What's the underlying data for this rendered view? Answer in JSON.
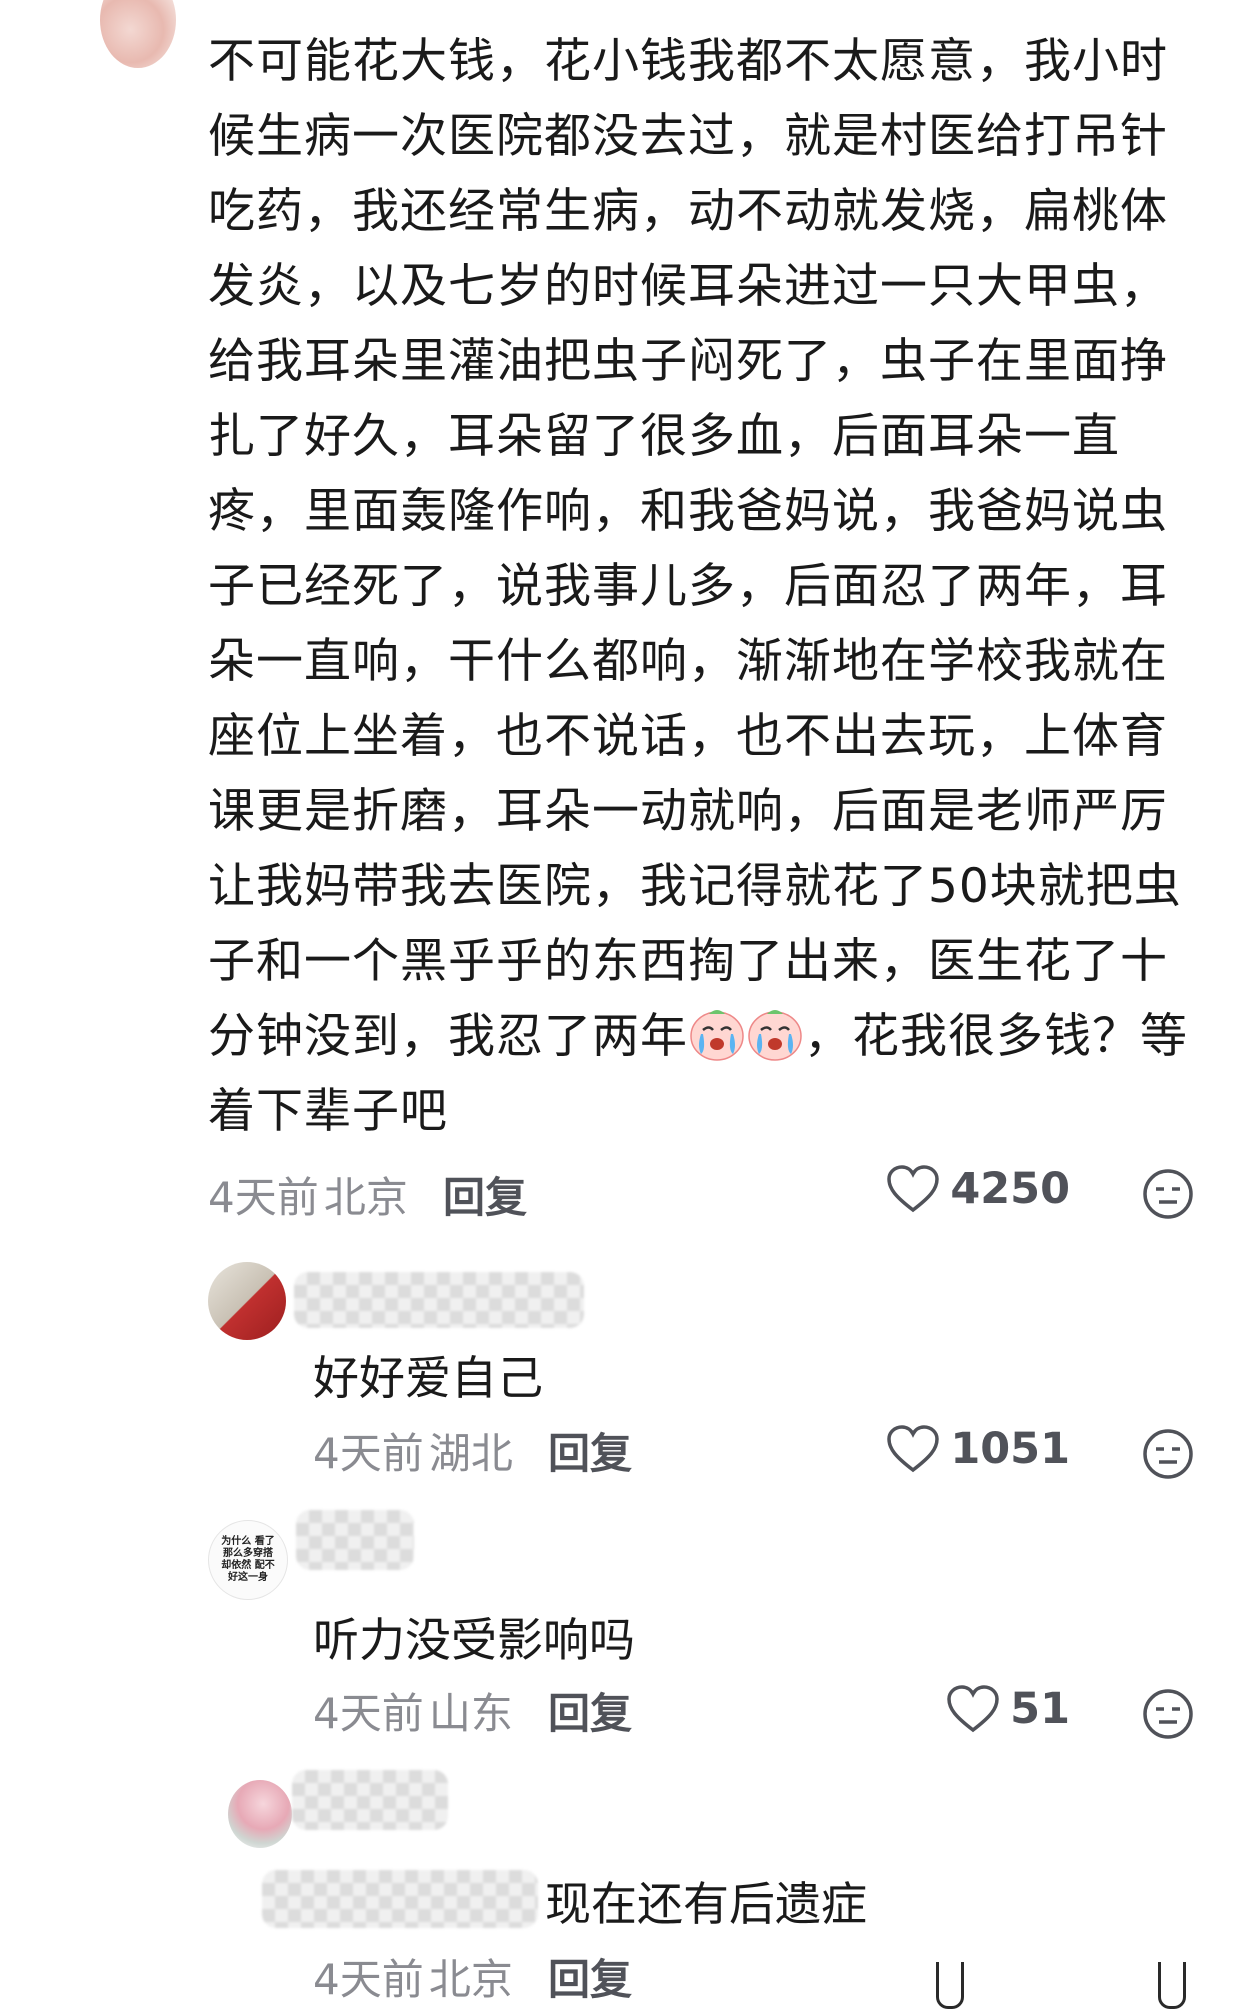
{
  "main_comment": {
    "text": "不可能花大钱，花小钱我都不太愿意，我小时候生病一次医院都没去过，就是村医给打吊针吃药，我还经常生病，动不动就发烧，扁桃体发炎，以及七岁的时候耳朵进过一只大甲虫，给我耳朵里灌油把虫子闷死了，虫子在里面挣扎了好久，耳朵留了很多血，后面耳朵一直疼，里面轰隆作响，和我爸妈说，我爸妈说虫子已经死了，说我事儿多，后面忍了两年，耳朵一直响，干什么都响，渐渐地在学校我就在座位上坐着，也不说话，也不出去玩，上体育课更是折磨，耳朵一动就响，后面是老师严厉让我妈带我去医院，我记得就花了50块就把虫子和一个黑乎乎的东西掏了出来，医生花了十分钟没到，我忍了两年",
    "text_tail": "，花我很多钱？等着下辈子吧",
    "emoji": "crying-face-emoji",
    "time": "4天前",
    "location": "北京",
    "reply_label": "回复",
    "likes": "4250"
  },
  "replies": [
    {
      "text": "好好爱自己",
      "time": "4天前",
      "location": "湖北",
      "reply_label": "回复",
      "likes": "1051"
    },
    {
      "text": "听力没受影响吗",
      "time": "4天前",
      "location": "山东",
      "reply_label": "回复",
      "likes": "51",
      "avatar_text": "为什么 看了那么多穿搭 却依然 配不好这一身"
    },
    {
      "text": "现在还有后遗症",
      "time": "4天前",
      "location": "北京",
      "reply_label": "回复"
    }
  ],
  "icons": {
    "like": "heart-outline-icon",
    "dislike": "neutral-face-icon"
  },
  "colors": {
    "text": "#1a1a1a",
    "meta": "#8a8b91",
    "action": "#505259"
  }
}
